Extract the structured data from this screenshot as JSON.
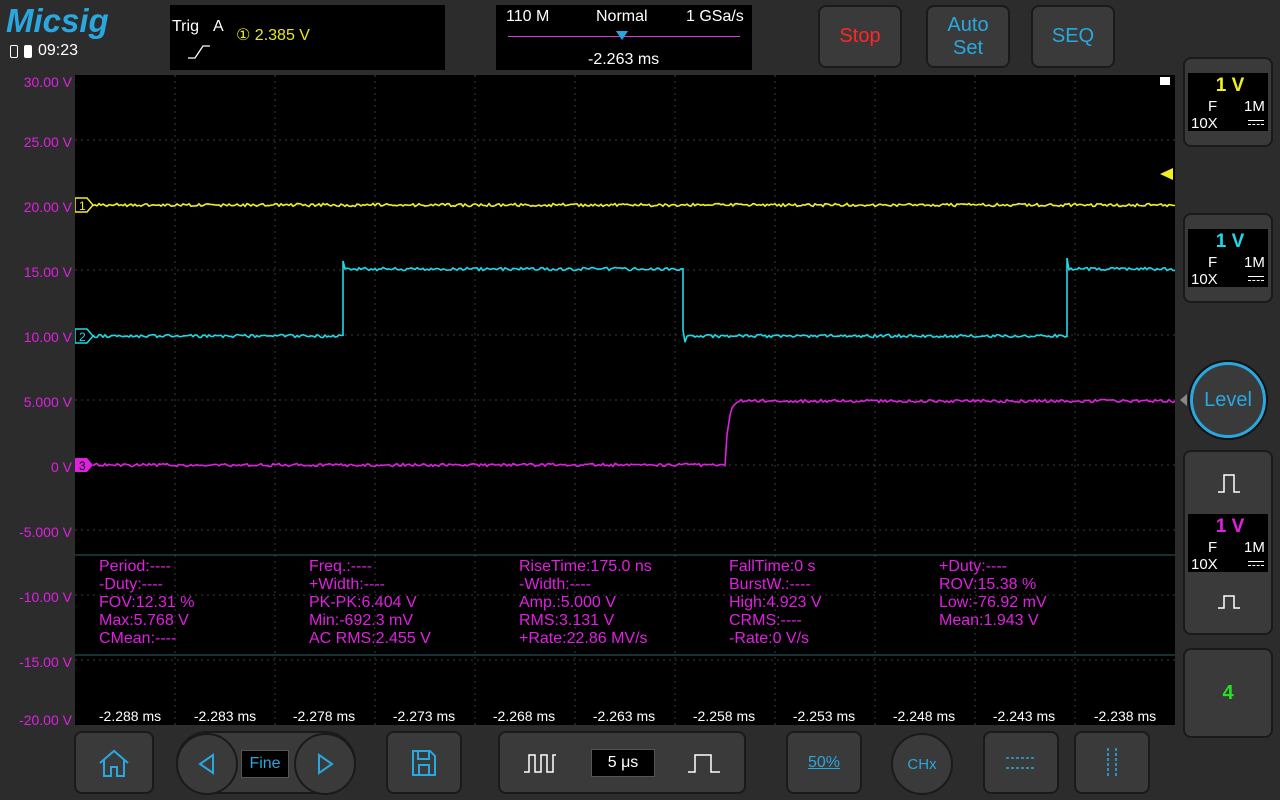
{
  "header": {
    "logo": "Micsig",
    "time": "09:23"
  },
  "trigger": {
    "label": "Trig",
    "source": "A",
    "channel_symbol": "①",
    "level": "2.385  V"
  },
  "acquisition": {
    "memory": "110 M",
    "mode": "Normal",
    "sample_rate": "1 GSa/s",
    "position": "-2.263 ms"
  },
  "buttons": {
    "stop": "Stop",
    "auto_line1": "Auto",
    "auto_line2": "Set",
    "seq": "SEQ"
  },
  "y_axis": [
    "30.00  V",
    "25.00  V",
    "20.00  V",
    "15.00  V",
    "10.00  V",
    "5.000  V",
    "0  V",
    "-5.000  V",
    "-10.00  V",
    "-15.00  V",
    "-20.00  V"
  ],
  "x_axis": [
    "-2.288 ms",
    "-2.283 ms",
    "-2.278 ms",
    "-2.273 ms",
    "-2.268 ms",
    "-2.263 ms",
    "-2.258 ms",
    "-2.253 ms",
    "-2.248 ms",
    "-2.243 ms",
    "-2.238 ms"
  ],
  "channel_markers": [
    "1",
    "2",
    "3"
  ],
  "measurements": [
    [
      "Period:----",
      "-Duty:----",
      "FOV:12.31 %",
      "Max:5.768 V",
      "CMean:----"
    ],
    [
      "Freq.:----",
      "+Width:----",
      "PK-PK:6.404 V",
      "Min:-692.3 mV",
      "AC RMS:2.455 V"
    ],
    [
      "RiseTime:175.0 ns",
      "-Width:----",
      "Amp.:5.000 V",
      "RMS:3.131 V",
      "+Rate:22.86 MV/s"
    ],
    [
      "FallTime:0 s",
      "BurstW.:----",
      "High:4.923 V",
      "CRMS:----",
      "-Rate:0 V/s"
    ],
    [
      "+Duty:----",
      "ROV:15.38 %",
      "Low:-76.92 mV",
      "Mean:1.943 V"
    ]
  ],
  "channels": [
    {
      "scale": "1 V",
      "coupling": "F",
      "impedance": "1M",
      "probe": "10X",
      "color": "#f0f020"
    },
    {
      "scale": "1 V",
      "coupling": "F",
      "impedance": "1M",
      "probe": "10X",
      "color": "#20d8e8"
    },
    {
      "scale": "1 V",
      "coupling": "F",
      "impedance": "1M",
      "probe": "10X",
      "color": "#e020e0"
    }
  ],
  "level_button": "Level",
  "ch4_label": "4",
  "bottom": {
    "fine": "Fine",
    "timebase": "5 μs",
    "fifty": "50%",
    "chx": "CHx"
  },
  "colors": {
    "ch1": "#f0f020",
    "ch2": "#20d8e8",
    "ch3": "#e020e0",
    "accent": "#29a8e0"
  }
}
